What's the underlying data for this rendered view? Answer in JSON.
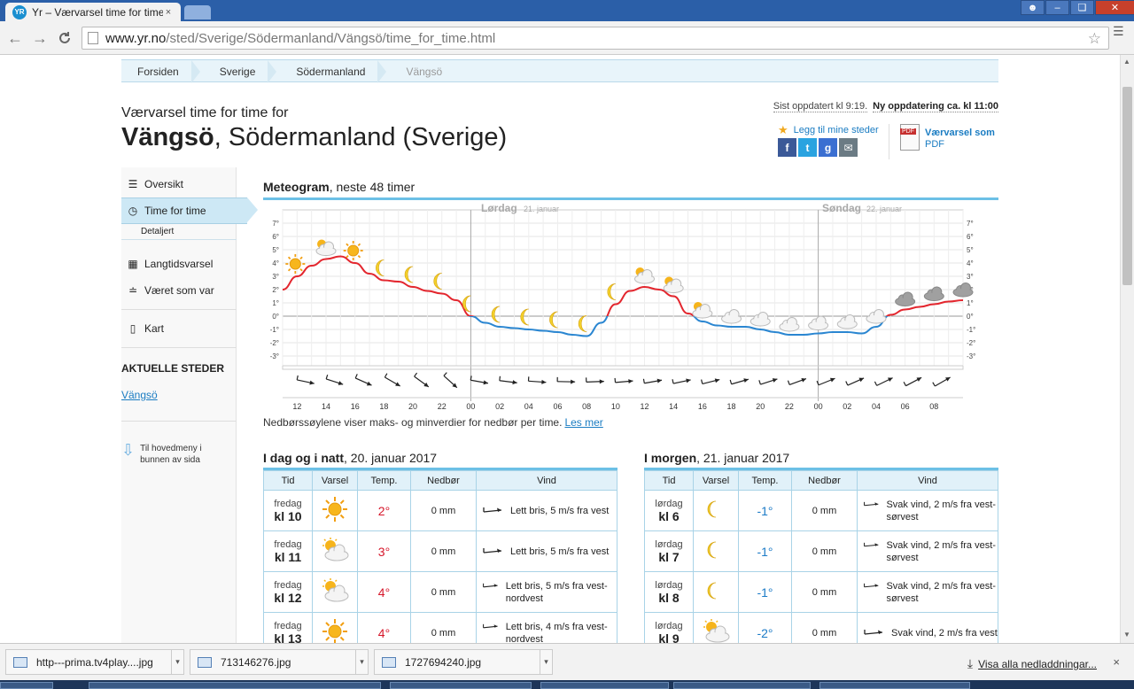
{
  "browser": {
    "tab_title": "Yr – Værvarsel time for time f",
    "tab_favicon": "YR",
    "tab_close": "×",
    "url_host": "www.yr.no",
    "url_path": "/sted/Sverige/Södermanland/Vängsö/time_for_time.html",
    "back": "←",
    "forward": "→",
    "reload": "C"
  },
  "breadcrumb": [
    "Forsiden",
    "Sverige",
    "Södermanland",
    "Vängsö"
  ],
  "header": {
    "kicker": "Værvarsel time for time for",
    "place": "Vängsö",
    "region": ", Södermanland (Sverige)",
    "updated": "Sist oppdatert kl 9:19.",
    "next_update": "Ny oppdatering ca. kl 11:00",
    "favorite": "Legg til mine steder",
    "pdf_line1": "Værvarsel som",
    "pdf_line2": "PDF",
    "pdf_badge": "PDF"
  },
  "sidebar": {
    "items": [
      {
        "label": "Oversikt",
        "icon": "list-icon"
      },
      {
        "label": "Time for time",
        "icon": "clock-icon"
      },
      {
        "label": "Detaljert",
        "icon": ""
      },
      {
        "label": "Langtidsvarsel",
        "icon": "calendar-icon"
      },
      {
        "label": "Været som var",
        "icon": "chart-icon"
      },
      {
        "label": "Kart",
        "icon": "map-icon"
      }
    ],
    "current_heading": "AKTUELLE STEDER",
    "current_place": "Vängsö",
    "to_menu": "Til hovedmeny i bunnen av sida"
  },
  "meteogram": {
    "title_bold": "Meteogram",
    "title_rest": ", neste 48 timer",
    "note": "Nedbørssøylene viser maks- og minverdier for nedbør per time.",
    "note_link": "Les mer",
    "day2_name": "Lørdag",
    "day2_date": "21. januar",
    "day3_name": "Søndag",
    "day3_date": "22. januar"
  },
  "chart_data": {
    "type": "line",
    "title": "Meteogram",
    "x": [
      "11",
      "12",
      "13",
      "14",
      "15",
      "16",
      "17",
      "18",
      "19",
      "20",
      "21",
      "22",
      "23",
      "00",
      "01",
      "02",
      "03",
      "04",
      "05",
      "06",
      "07",
      "08",
      "09",
      "10",
      "11",
      "12",
      "13",
      "14",
      "15",
      "16",
      "17",
      "18",
      "19",
      "20",
      "21",
      "22",
      "23",
      "00",
      "01",
      "02",
      "03",
      "04",
      "05",
      "06",
      "07",
      "08",
      "09",
      "10"
    ],
    "x_tick_labels": [
      "12",
      "14",
      "16",
      "18",
      "20",
      "22",
      "00",
      "02",
      "04",
      "06",
      "08",
      "10",
      "12",
      "14",
      "16",
      "18",
      "20",
      "22",
      "00",
      "02",
      "04",
      "06",
      "08"
    ],
    "y_tick_labels": [
      "7°",
      "6°",
      "5°",
      "4°",
      "3°",
      "2°",
      "1°",
      "0°",
      "-1°",
      "-2°",
      "-3°"
    ],
    "series": [
      {
        "values": [
          2,
          3,
          3.8,
          4.3,
          4.5,
          4,
          3.2,
          2.7,
          2.6,
          2.2,
          1.9,
          1.7,
          1.2,
          0,
          -0.5,
          -0.8,
          -0.9,
          -1,
          -1.1,
          -1.2,
          -1.4,
          -1.5,
          -0.5,
          0.9,
          1.9,
          2.2,
          2.0,
          1.5,
          0.2,
          -0.4,
          -0.7,
          -0.8,
          -0.8,
          -1.0,
          -1.2,
          -1.4,
          -1.4,
          -1.3,
          -1.2,
          -1.2,
          -1.3,
          -0.8,
          0.1,
          0.5,
          0.7,
          0.9,
          1.1,
          1.2
        ]
      }
    ],
    "ylim": [
      -3,
      7
    ],
    "symbols": [
      "sun",
      "partly-cloudy",
      "sun",
      "moon",
      "moon",
      "moon",
      "moon",
      "moon",
      "moon",
      "moon",
      "moon",
      "moon",
      "partly-cloudy",
      "partly-cloudy",
      "partly-cloudy",
      "cloud",
      "cloud",
      "cloud",
      "cloud",
      "cloud",
      "cloud",
      "dark-cloud",
      "dark-cloud",
      "dark-cloud"
    ],
    "grid": true,
    "colors": {
      "warm": "#e3262e",
      "cold": "#2a86d1",
      "zero": "#999999"
    }
  },
  "today": {
    "title_bold": "I dag og i natt",
    "title_rest": ", 20. januar 2017",
    "headers": [
      "Tid",
      "Varsel",
      "Temp.",
      "Nedbør",
      "Vind"
    ],
    "rows": [
      {
        "day": "fredag",
        "time": "kl 10",
        "symbol": "sun-icon",
        "temp": "2°",
        "precip": "0 mm",
        "wind": "Lett bris, 5 m/s fra vest"
      },
      {
        "day": "fredag",
        "time": "kl 11",
        "symbol": "partly-cloudy-icon",
        "temp": "3°",
        "precip": "0 mm",
        "wind": "Lett bris, 5 m/s fra vest"
      },
      {
        "day": "fredag",
        "time": "kl 12",
        "symbol": "partly-cloudy-icon",
        "temp": "4°",
        "precip": "0 mm",
        "wind": "Lett bris, 5 m/s fra vest-nordvest"
      },
      {
        "day": "fredag",
        "time": "kl 13",
        "symbol": "sun-icon",
        "temp": "4°",
        "precip": "0 mm",
        "wind": "Lett bris, 4 m/s fra vest-nordvest"
      }
    ]
  },
  "tomorrow": {
    "title_bold": "I morgen",
    "title_rest": ", 21. januar 2017",
    "headers": [
      "Tid",
      "Varsel",
      "Temp.",
      "Nedbør",
      "Vind"
    ],
    "rows": [
      {
        "day": "lørdag",
        "time": "kl 6",
        "symbol": "moon-icon",
        "temp": "-1°",
        "precip": "0 mm",
        "wind": "Svak vind, 2 m/s fra vest-sørvest"
      },
      {
        "day": "lørdag",
        "time": "kl 7",
        "symbol": "moon-icon",
        "temp": "-1°",
        "precip": "0 mm",
        "wind": "Svak vind, 2 m/s fra vest-sørvest"
      },
      {
        "day": "lørdag",
        "time": "kl 8",
        "symbol": "moon-icon",
        "temp": "-1°",
        "precip": "0 mm",
        "wind": "Svak vind, 2 m/s fra vest-sørvest"
      },
      {
        "day": "lørdag",
        "time": "kl 9",
        "symbol": "partly-cloudy-icon",
        "temp": "-2°",
        "precip": "0 mm",
        "wind": "Svak vind, 2 m/s fra vest"
      }
    ]
  },
  "downloads": {
    "items": [
      "http---prima.tv4play....jpg",
      "713146276.jpg",
      "1727694240.jpg"
    ],
    "show_all": "Visa alla nedladdningar...",
    "close": "×"
  }
}
